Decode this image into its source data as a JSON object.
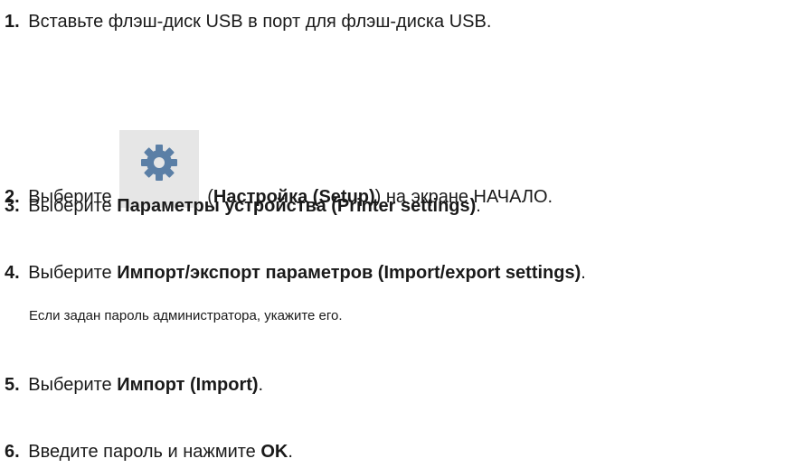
{
  "steps": [
    {
      "num": "1.",
      "text": "Вставьте флэш-диск USB в порт для флэш-диска USB."
    },
    {
      "num": "2.",
      "before": "Выберите",
      "icon": "gear-icon",
      "paren_open": " (",
      "bold": "Настройка (Setup)",
      "after": ") на экране НАЧАЛО."
    },
    {
      "num": "3.",
      "before": "Выберите ",
      "bold": "Параметры устройства (Printer settings)",
      "after": "."
    },
    {
      "num": "4.",
      "before": "Выберите ",
      "bold": "Импорт/экспорт параметров (Import/export settings)",
      "after": ".",
      "note": "Если задан пароль администратора, укажите его."
    },
    {
      "num": "5.",
      "before": "Выберите ",
      "bold": "Импорт (Import)",
      "after": "."
    },
    {
      "num": "6.",
      "before": "Введите пароль и нажмите ",
      "bold": "OK",
      "after": "."
    }
  ],
  "colors": {
    "text": "#1a1a1a",
    "icon_bg": "#e6e6e6",
    "icon_fg": "#5b7fa6"
  }
}
